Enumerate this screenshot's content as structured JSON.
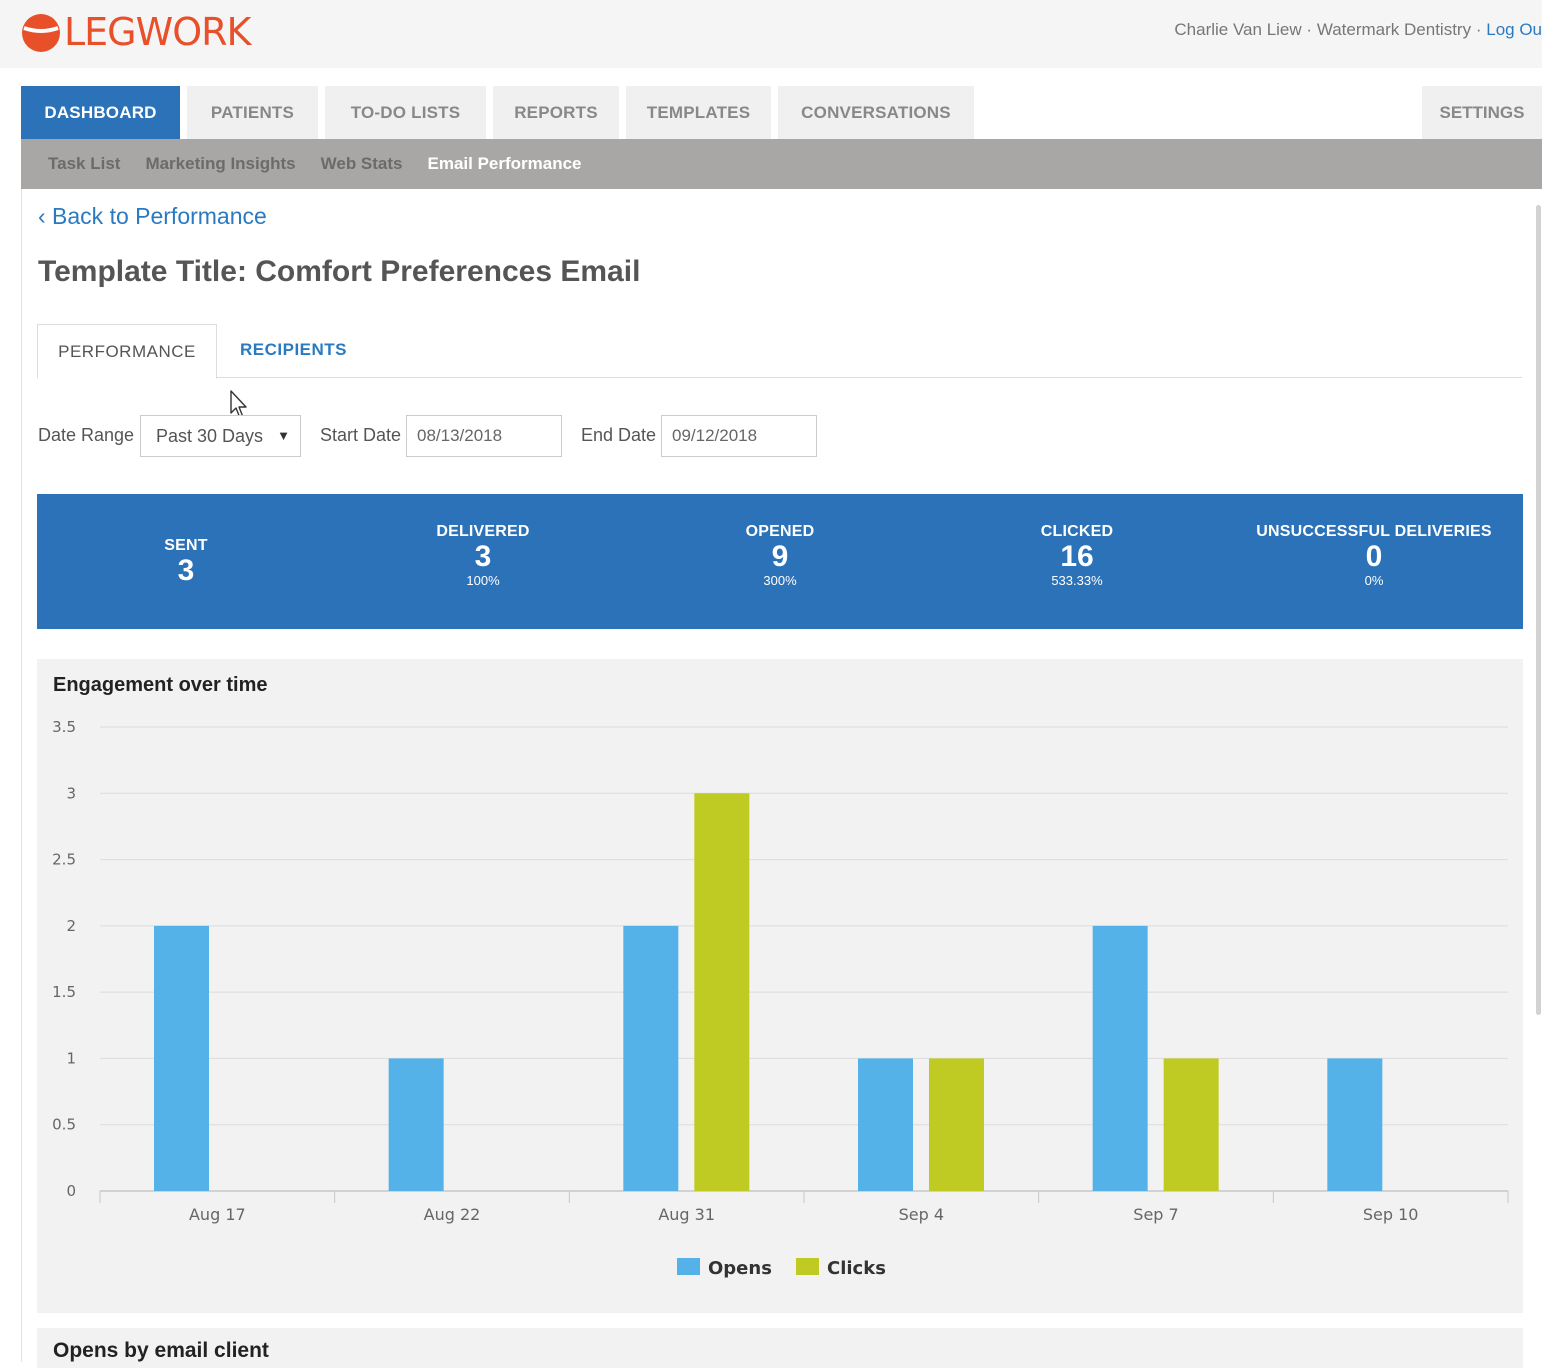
{
  "header": {
    "logo_text": "LEGWORK",
    "user_name": "Charlie Van Liew",
    "practice": "Watermark Dentistry",
    "separator": "·",
    "logout": "Log Ou"
  },
  "mainnav": {
    "tabs": [
      {
        "label": "DASHBOARD",
        "active": true
      },
      {
        "label": "PATIENTS",
        "active": false
      },
      {
        "label": "TO-DO LISTS",
        "active": false
      },
      {
        "label": "REPORTS",
        "active": false
      },
      {
        "label": "TEMPLATES",
        "active": false
      },
      {
        "label": "CONVERSATIONS",
        "active": false
      }
    ],
    "settings": "SETTINGS"
  },
  "subnav": {
    "items": [
      {
        "label": "Task List",
        "active": false
      },
      {
        "label": "Marketing Insights",
        "active": false
      },
      {
        "label": "Web Stats",
        "active": false
      },
      {
        "label": "Email Performance",
        "active": true
      }
    ]
  },
  "page": {
    "back_link": "‹ Back to Performance",
    "title": "Template Title: Comfort Preferences Email",
    "tabs": {
      "performance": "PERFORMANCE",
      "recipients": "RECIPIENTS"
    }
  },
  "filters": {
    "date_range_label": "Date Range",
    "date_range_value": "Past 30 Days",
    "start_label": "Start Date",
    "start_value": "08/13/2018",
    "end_label": "End Date",
    "end_value": "09/12/2018"
  },
  "stats": {
    "sent": {
      "label": "SENT",
      "value": "3"
    },
    "delivered": {
      "label": "DELIVERED",
      "value": "3",
      "pct": "100%"
    },
    "opened": {
      "label": "OPENED",
      "value": "9",
      "pct": "300%"
    },
    "clicked": {
      "label": "CLICKED",
      "value": "16",
      "pct": "533.33%"
    },
    "unsuccessful": {
      "label": "UNSUCCESSFUL DELIVERIES",
      "value": "0",
      "pct": "0%"
    }
  },
  "colors": {
    "primary": "#2b72b8",
    "opens": "#55b2e8",
    "clicks": "#bfcb23",
    "brand": "#e8502a"
  },
  "chart_data": {
    "type": "bar",
    "title": "Engagement over time",
    "categories": [
      "Aug 17",
      "Aug 22",
      "Aug 31",
      "Sep 4",
      "Sep 7",
      "Sep 10"
    ],
    "series": [
      {
        "name": "Opens",
        "values": [
          2,
          1,
          2,
          1,
          2,
          1
        ]
      },
      {
        "name": "Clicks",
        "values": [
          0,
          0,
          3,
          1,
          1,
          0
        ]
      }
    ],
    "ylim": [
      0,
      3.5
    ],
    "yticks": [
      "0",
      "0.5",
      "1",
      "1.5",
      "2",
      "2.5",
      "3",
      "3.5"
    ],
    "grid": true,
    "legend": "bottom-center"
  },
  "next_panel": {
    "title": "Opens by email client"
  }
}
